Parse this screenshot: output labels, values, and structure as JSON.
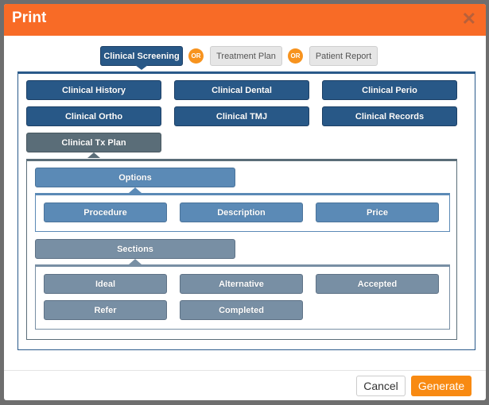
{
  "dialog": {
    "title": "Print",
    "close_icon": "close-icon"
  },
  "report_types": [
    {
      "label": "Clinical Screening",
      "selected": true
    },
    {
      "label": "Treatment Plan",
      "selected": false
    },
    {
      "label": "Patient Report",
      "selected": false
    }
  ],
  "or_label": "OR",
  "clinical_items": [
    "Clinical History",
    "Clinical Dental",
    "Clinical Perio",
    "Clinical Ortho",
    "Clinical TMJ",
    "Clinical Records",
    "Clinical Tx Plan"
  ],
  "options": {
    "label": "Options",
    "items": [
      "Procedure",
      "Description",
      "Price"
    ]
  },
  "sections": {
    "label": "Sections",
    "items": [
      "Ideal",
      "Alternative",
      "Accepted",
      "Refer",
      "Completed"
    ]
  },
  "footer": {
    "cancel": "Cancel",
    "generate": "Generate"
  },
  "colors": {
    "header": "#f86b26",
    "primary": "#285887",
    "accent": "#f7931e"
  }
}
